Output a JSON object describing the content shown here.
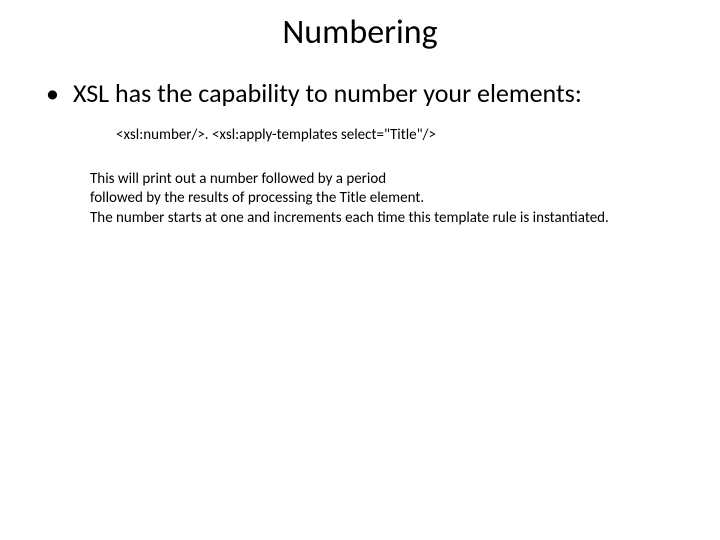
{
  "title": "Numbering",
  "bullet": {
    "marker": "•",
    "text": "XSL has the capability to number your elements:"
  },
  "code": "<xsl:number/>. <xsl:apply-templates select=\"Title\"/>",
  "description": "This will print out a number followed by a period\nfollowed by the results of processing the Title element.\nThe number starts at one and increments each time this template rule is instantiated."
}
